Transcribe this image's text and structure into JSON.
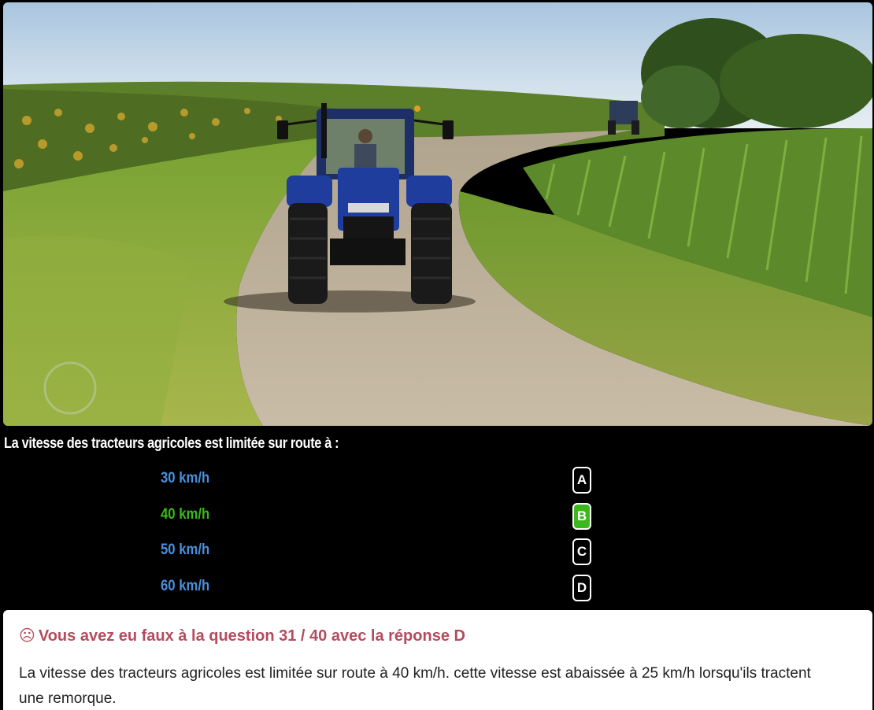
{
  "photo": {
    "description_name": "tractor-on-country-road-photo"
  },
  "question": {
    "text": "La vitesse des tracteurs agricoles est limitée sur route à :"
  },
  "answers": [
    {
      "label": "30 km/h",
      "key": "A",
      "color": "#4a8fd8"
    },
    {
      "label": "40 km/h",
      "key": "B",
      "color": "#3db81c"
    },
    {
      "label": "50 km/h",
      "key": "C",
      "color": "#4a8fd8"
    },
    {
      "label": "60 km/h",
      "key": "D",
      "color": "#4a8fd8"
    }
  ],
  "feedback": {
    "icon": "sad-face-icon",
    "icon_glyph": "☹",
    "title": "Vous avez eu faux à la question 31 / 40 avec la réponse D",
    "body": "La vitesse des tracteurs agricoles est limitée sur route à 40 km/h. cette vitesse est abaissée à 25 km/h lorsqu'ils tractent une remorque.",
    "title_color": "#b44b5e"
  }
}
